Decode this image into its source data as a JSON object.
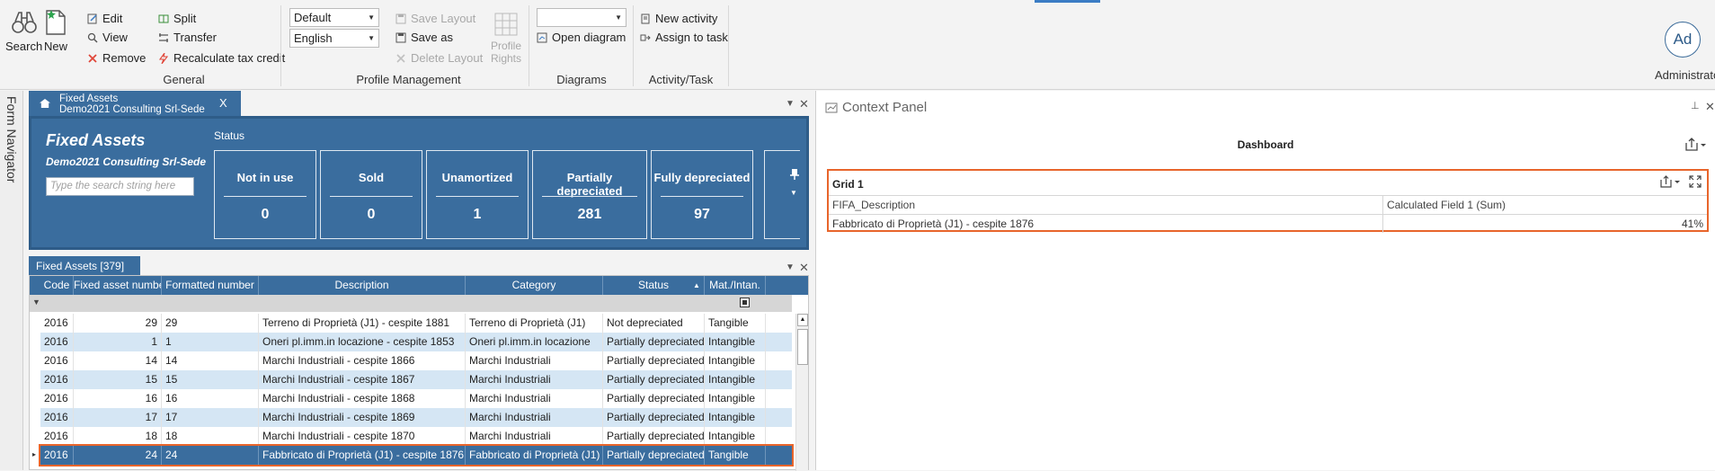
{
  "ribbon": {
    "search_label": "Search",
    "new_label": "New",
    "general": {
      "edit": "Edit",
      "view": "View",
      "remove": "Remove",
      "split": "Split",
      "transfer": "Transfer",
      "recalculate": "Recalculate tax credit",
      "group_label": "General"
    },
    "profile": {
      "layout_value": "Default",
      "language_value": "English",
      "save_layout": "Save Layout",
      "save_as": "Save as",
      "delete_layout": "Delete Layout",
      "profile_rights_1": "Profile",
      "profile_rights_2": "Rights",
      "group_label": "Profile Management"
    },
    "diagrams": {
      "combo_value": "",
      "open_diagram": "Open diagram",
      "group_label": "Diagrams"
    },
    "activity": {
      "new_activity": "New activity",
      "assign_to_task": "Assign to task",
      "group_label": "Activity/Task"
    },
    "user": {
      "initials": "Ad",
      "name": "Administrator"
    }
  },
  "nav": {
    "form_navigator": "Form Navigator"
  },
  "document_tab": {
    "line1": "Fixed Assets",
    "line2": "Demo2021 Consulting Srl-Sede",
    "close": "X"
  },
  "summary": {
    "title": "Fixed Assets",
    "company": "Demo2021 Consulting Srl-Sede",
    "search_placeholder": "Type the search string here",
    "status_label": "Status",
    "cards": [
      {
        "label": "Not in use",
        "value": "0"
      },
      {
        "label": "Sold",
        "value": "0"
      },
      {
        "label": "Unamortized",
        "value": "1"
      },
      {
        "label": "Partially depreciated",
        "value": "281"
      },
      {
        "label": "Fully depreciated",
        "value": "97"
      }
    ]
  },
  "grid": {
    "tab_label": "Fixed Assets [379]",
    "columns": [
      "Code",
      "Fixed asset number",
      "Formatted number",
      "Description",
      "Category",
      "Status",
      "Mat./Intan."
    ],
    "rows": [
      [
        "2016",
        "29",
        "29",
        "Terreno di Proprietà (J1) - cespite 1881",
        "Terreno di Proprietà (J1)",
        "Not depreciated",
        "Tangible"
      ],
      [
        "2016",
        "1",
        "1",
        "Oneri pl.imm.in locazione - cespite 1853",
        "Oneri pl.imm.in locazione",
        "Partially depreciated",
        "Intangible"
      ],
      [
        "2016",
        "14",
        "14",
        "Marchi Industriali - cespite 1866",
        "Marchi Industriali",
        "Partially depreciated",
        "Intangible"
      ],
      [
        "2016",
        "15",
        "15",
        "Marchi Industriali - cespite 1867",
        "Marchi Industriali",
        "Partially depreciated",
        "Intangible"
      ],
      [
        "2016",
        "16",
        "16",
        "Marchi Industriali - cespite 1868",
        "Marchi Industriali",
        "Partially depreciated",
        "Intangible"
      ],
      [
        "2016",
        "17",
        "17",
        "Marchi Industriali - cespite 1869",
        "Marchi Industriali",
        "Partially depreciated",
        "Intangible"
      ],
      [
        "2016",
        "18",
        "18",
        "Marchi Industriali - cespite 1870",
        "Marchi Industriali",
        "Partially depreciated",
        "Intangible"
      ],
      [
        "2016",
        "24",
        "24",
        "Fabbricato di Proprietà (J1) - cespite 1876",
        "Fabbricato di Proprietà (J1)",
        "Partially depreciated",
        "Tangible"
      ]
    ],
    "selected_row": 7
  },
  "context": {
    "title": "Context Panel",
    "dashboard_title": "Dashboard",
    "grid1": {
      "title": "Grid 1",
      "columns": [
        "FIFA_Description",
        "Calculated Field 1 (Sum)"
      ],
      "row": [
        "Fabbricato di Proprietà (J1) - cespite 1876",
        "41%"
      ]
    }
  },
  "colors": {
    "header_blue": "#3a6d9e",
    "alt_row_blue": "#d5e6f4",
    "highlight_orange": "#e8652b"
  }
}
